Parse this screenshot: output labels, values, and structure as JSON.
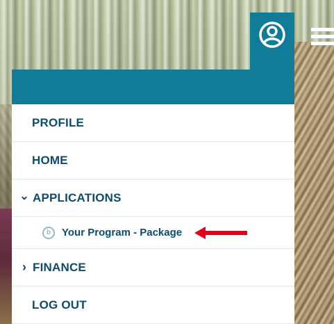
{
  "menu": {
    "items": [
      {
        "label": "PROFILE",
        "chevron": ""
      },
      {
        "label": "HOME",
        "chevron": ""
      },
      {
        "label": "APPLICATIONS",
        "chevron": "⌄"
      },
      {
        "label": "FINANCE",
        "chevron": "›"
      },
      {
        "label": "LOG OUT",
        "chevron": ""
      }
    ],
    "sub_items": [
      {
        "label": "Your Program - Package",
        "icon": "program-icon"
      }
    ]
  },
  "header": {
    "user_icon": "user-circle-icon",
    "menu_icon": "hamburger-menu-icon"
  },
  "colors": {
    "accent": "#117c98",
    "text": "#0d4b6b",
    "annotation_arrow": "#e3001b"
  }
}
